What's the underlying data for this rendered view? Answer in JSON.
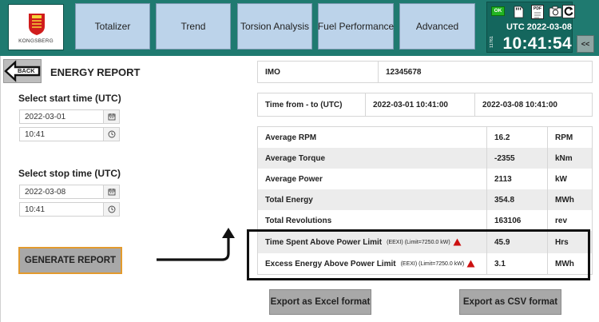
{
  "header": {
    "logo_text": "KONGSBERG",
    "nav": [
      "Totalizer",
      "Trend",
      "Torsion Analysis",
      "Fuel Performance",
      "Advanced"
    ],
    "status": {
      "ok_label": "OK",
      "pdf_label": "PDF",
      "utc_label": "UTC",
      "date": "2022-03-08",
      "time": "10:41:54",
      "time_tag": "11761"
    },
    "collapse_label": "<<"
  },
  "left": {
    "back_label": "BACK",
    "title": "ENERGY REPORT",
    "start_label": "Select start time (UTC)",
    "start_date": "2022-03-01",
    "start_time": "10:41",
    "stop_label": "Select stop time (UTC)",
    "stop_date": "2022-03-08",
    "stop_time": "10:41",
    "generate_label": "GENERATE REPORT"
  },
  "imo": {
    "label": "IMO",
    "value": "12345678"
  },
  "range": {
    "label": "Time from - to (UTC)",
    "from": "2022-03-01 10:41:00",
    "to": "2022-03-08 10:41:00"
  },
  "stats": [
    {
      "label": "Average RPM",
      "value": "16.2",
      "unit": "RPM"
    },
    {
      "label": "Average Torque",
      "value": "-2355",
      "unit": "kNm"
    },
    {
      "label": "Average Power",
      "value": "2113",
      "unit": "kW"
    },
    {
      "label": "Total Energy",
      "value": "354.8",
      "unit": "MWh"
    },
    {
      "label": "Total Revolutions",
      "value": "163106",
      "unit": "rev"
    },
    {
      "label": "Time Spent Above Power Limit",
      "note": "(EEXI)  (Limit=7250.0 kW)",
      "value": "45.9",
      "unit": "Hrs"
    },
    {
      "label": "Excess Energy Above Power Limit",
      "note": "(EEXI)  (Limit=7250.0 kW)",
      "value": "3.1",
      "unit": "MWh"
    }
  ],
  "export": {
    "excel_label": "Export as Excel format",
    "csv_label": "Export as CSV format"
  },
  "colors": {
    "header": "#1f7a70",
    "nav_button": "#bcd3ea",
    "warning": "#cc1111",
    "highlight_border": "#e39a2d"
  }
}
